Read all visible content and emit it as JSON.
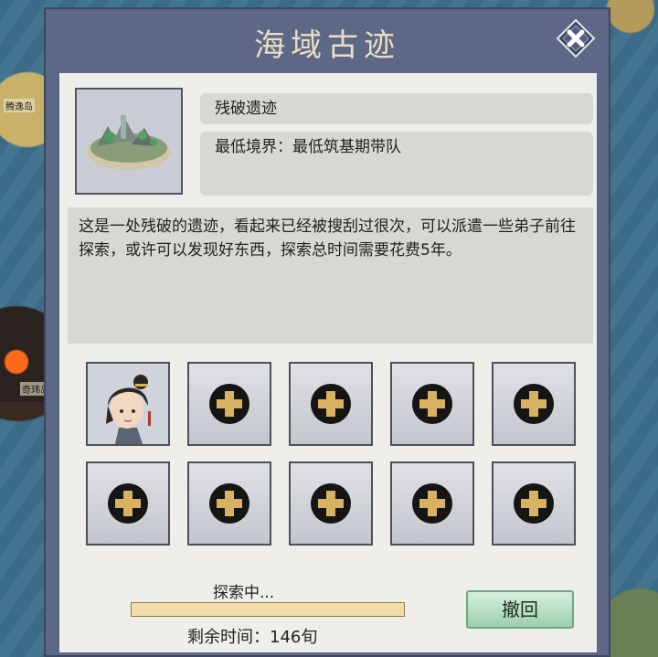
{
  "map": {
    "label_1": "腾逸岛",
    "label_2": "奇玮岛"
  },
  "dialog": {
    "title": "海域古迹",
    "site_name": "残破遗迹",
    "requirement": "最低境界：最低筑基期带队",
    "description": "这是一处残破的遗迹，看起来已经被搜刮过很次，可以派遣一些弟子前往探索，或许可以发现好东西，探索总时间需要花费5年。",
    "slots": {
      "row1": [
        "occupied",
        "empty",
        "empty",
        "empty",
        "empty"
      ],
      "row2": [
        "empty",
        "empty",
        "empty",
        "empty",
        "empty"
      ]
    },
    "status_text": "探索中...",
    "progress_fraction": 1.0,
    "remaining_text": "剩余时间：146旬",
    "withdraw_label": "撤回"
  }
}
